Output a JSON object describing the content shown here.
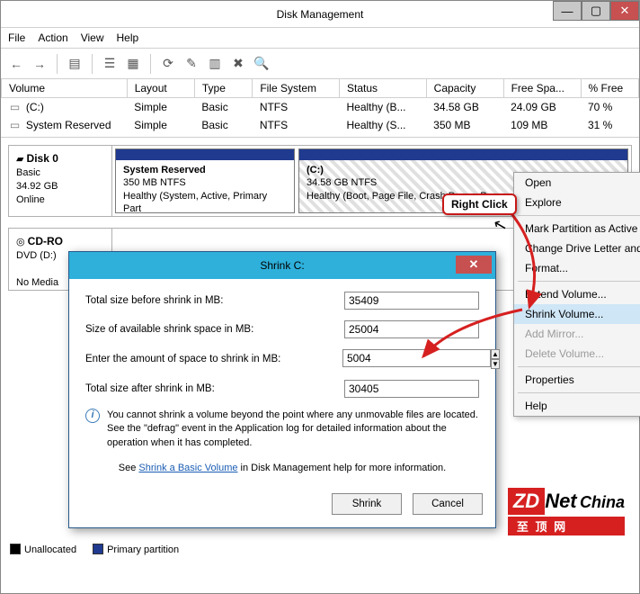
{
  "window": {
    "title": "Disk Management"
  },
  "menu": {
    "file": "File",
    "action": "Action",
    "view": "View",
    "help": "Help"
  },
  "toolbar_icons": {
    "back": "←",
    "forward": "→",
    "list1": "▤",
    "list2": "▦",
    "tree": "☰",
    "props": "▥",
    "refresh": "⟳",
    "edit": "✎",
    "del": "✖",
    "find": "🔍",
    "help": "?"
  },
  "table": {
    "headers": {
      "volume": "Volume",
      "layout": "Layout",
      "type": "Type",
      "fs": "File System",
      "status": "Status",
      "capacity": "Capacity",
      "free": "Free Spa...",
      "pct": "% Free"
    },
    "rows": [
      {
        "volume": " (C:)",
        "layout": "Simple",
        "type": "Basic",
        "fs": "NTFS",
        "status": "Healthy (B...",
        "capacity": "34.58 GB",
        "free": "24.09 GB",
        "pct": "70 %"
      },
      {
        "volume": " System Reserved",
        "layout": "Simple",
        "type": "Basic",
        "fs": "NTFS",
        "status": "Healthy (S...",
        "capacity": "350 MB",
        "free": "109 MB",
        "pct": "31 %"
      }
    ]
  },
  "disks": {
    "disk0": {
      "label_title": "Disk 0",
      "label_type": "Basic",
      "label_size": "34.92 GB",
      "label_state": "Online",
      "parts": [
        {
          "name": "System Reserved",
          "size": "350 MB NTFS",
          "status": "Healthy (System, Active, Primary Part"
        },
        {
          "name": "(C:)",
          "size": "34.58 GB NTFS",
          "status": "Healthy (Boot, Page File, Crash Dump, P"
        }
      ]
    },
    "cdrom": {
      "label_title": "CD-RO",
      "label_sub": "DVD (D:)",
      "label_state": "No Media"
    }
  },
  "legend": {
    "unalloc": "Unallocated",
    "primary": "Primary partition"
  },
  "context_menu": [
    {
      "label": "Open",
      "enabled": true
    },
    {
      "label": "Explore",
      "enabled": true
    },
    {
      "sep": true
    },
    {
      "label": "Mark Partition as Active",
      "enabled": true
    },
    {
      "label": "Change Drive Letter and",
      "enabled": true
    },
    {
      "label": "Format...",
      "enabled": true
    },
    {
      "sep": true
    },
    {
      "label": "Extend Volume...",
      "enabled": true
    },
    {
      "label": "Shrink Volume...",
      "enabled": true,
      "hover": true
    },
    {
      "label": "Add Mirror...",
      "enabled": false
    },
    {
      "label": "Delete Volume...",
      "enabled": false
    },
    {
      "sep": true
    },
    {
      "label": "Properties",
      "enabled": true
    },
    {
      "sep": true
    },
    {
      "label": "Help",
      "enabled": true
    }
  ],
  "callout": "Right Click",
  "dialog": {
    "title": "Shrink C:",
    "rows": {
      "total_before": {
        "label": "Total size before shrink in MB:",
        "value": "35409"
      },
      "available": {
        "label": "Size of available shrink space in MB:",
        "value": "25004"
      },
      "enter": {
        "label": "Enter the amount of space to shrink in MB:",
        "value": "5004"
      },
      "total_after": {
        "label": "Total size after shrink in MB:",
        "value": "30405"
      }
    },
    "info": "You cannot shrink a volume beyond the point where any unmovable files are located. See the \"defrag\" event in the Application log for detailed information about the operation when it has completed.",
    "help_pre": "See ",
    "help_link": "Shrink a Basic Volume",
    "help_post": " in Disk Management help for more information.",
    "buttons": {
      "shrink": "Shrink",
      "cancel": "Cancel"
    }
  },
  "watermark": {
    "zd": "ZD",
    "net": "Net",
    "china": "China",
    "sub": "至 顶 网"
  }
}
